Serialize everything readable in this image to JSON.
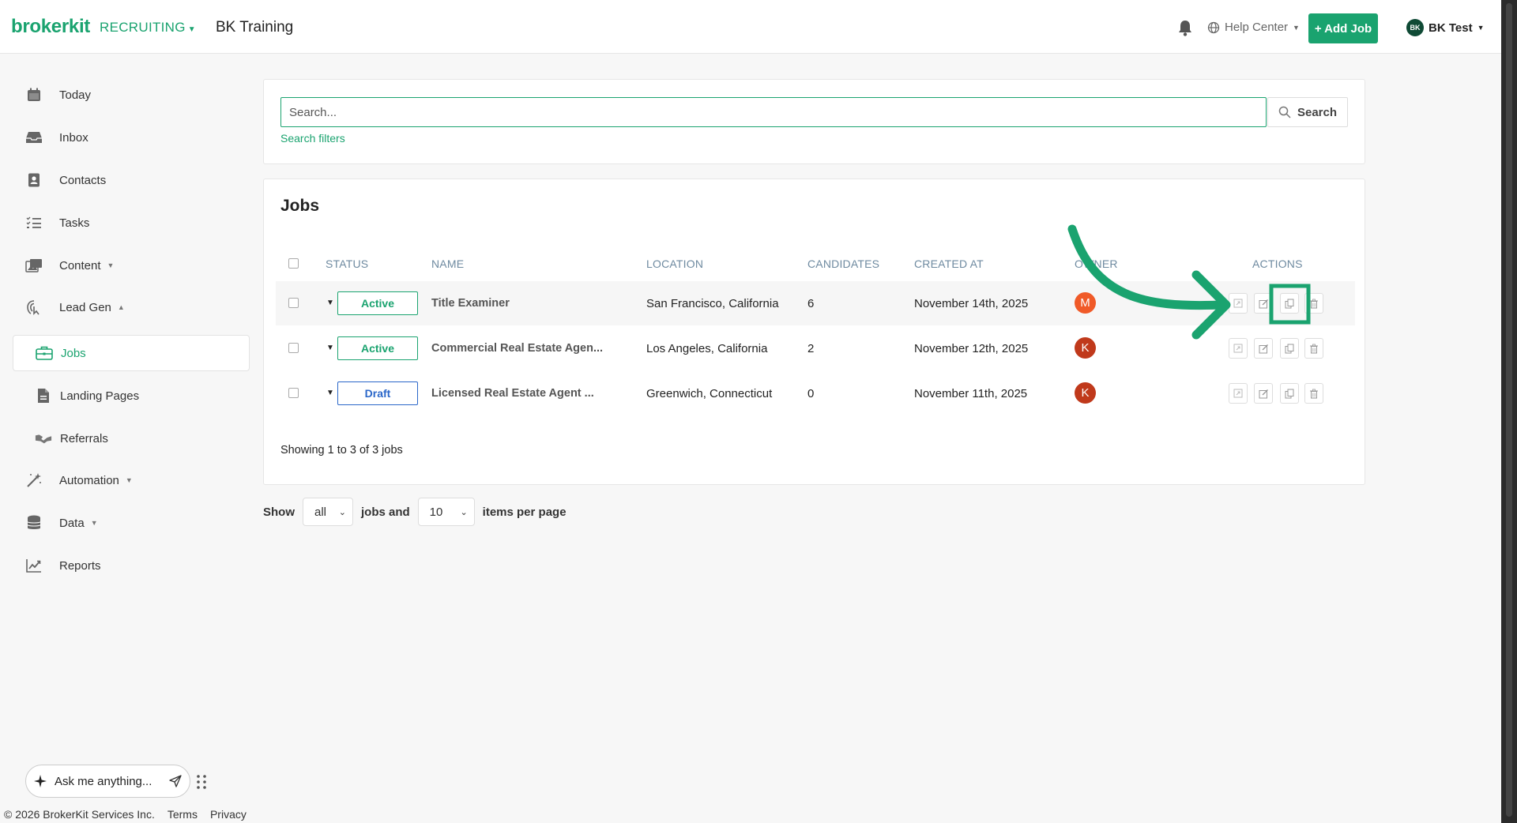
{
  "header": {
    "logo": "brokerkit",
    "module": "RECRUITING",
    "workspace": "BK Training",
    "help": "Help Center",
    "add_job": "+ Add Job",
    "user_initials": "BK",
    "user_name": "BK Test"
  },
  "sidebar": {
    "items": [
      {
        "label": "Today",
        "icon": "calendar-icon"
      },
      {
        "label": "Inbox",
        "icon": "inbox-icon"
      },
      {
        "label": "Contacts",
        "icon": "contact-card-icon"
      },
      {
        "label": "Tasks",
        "icon": "task-list-icon"
      },
      {
        "label": "Content",
        "icon": "content-icon"
      },
      {
        "label": "Lead Gen",
        "icon": "lead-gen-icon"
      },
      {
        "label": "Jobs",
        "icon": "briefcase-icon"
      },
      {
        "label": "Landing Pages",
        "icon": "page-icon"
      },
      {
        "label": "Referrals",
        "icon": "handshake-icon"
      },
      {
        "label": "Automation",
        "icon": "magic-wand-icon"
      },
      {
        "label": "Data",
        "icon": "database-icon"
      },
      {
        "label": "Reports",
        "icon": "chart-icon"
      }
    ]
  },
  "search": {
    "placeholder": "Search...",
    "button": "Search",
    "filters": "Search filters"
  },
  "jobs": {
    "title": "Jobs",
    "columns": [
      "STATUS",
      "NAME",
      "LOCATION",
      "CANDIDATES",
      "CREATED AT",
      "OWNER",
      "ACTIONS"
    ],
    "rows": [
      {
        "status": "Active",
        "name": "Title Examiner",
        "location": "San Francisco, California",
        "candidates": "6",
        "created": "November 14th, 2025",
        "owner": "M"
      },
      {
        "status": "Active",
        "name": "Commercial Real Estate Agen...",
        "location": "Los Angeles, California",
        "candidates": "2",
        "created": "November 12th, 2025",
        "owner": "K"
      },
      {
        "status": "Draft",
        "name": "Licensed Real Estate Agent ...",
        "location": "Greenwich, Connecticut",
        "candidates": "0",
        "created": "November 11th, 2025",
        "owner": "K"
      }
    ],
    "showing": "Showing 1 to 3 of 3 jobs"
  },
  "pagination": {
    "show": "Show",
    "filter_value": "all",
    "jobs_and": "jobs and",
    "per_page_value": "10",
    "items_per_page": "items per page"
  },
  "assistant": {
    "placeholder": "Ask me anything..."
  },
  "footer": {
    "copyright": "© 2026 BrokerKit Services Inc.",
    "terms": "Terms",
    "privacy": "Privacy"
  },
  "colors": {
    "brand": "#1aa36f",
    "draft": "#2a66c9",
    "owner_m": "#f05a28",
    "owner_k": "#c0391b",
    "annotation": "#1aa36f"
  }
}
